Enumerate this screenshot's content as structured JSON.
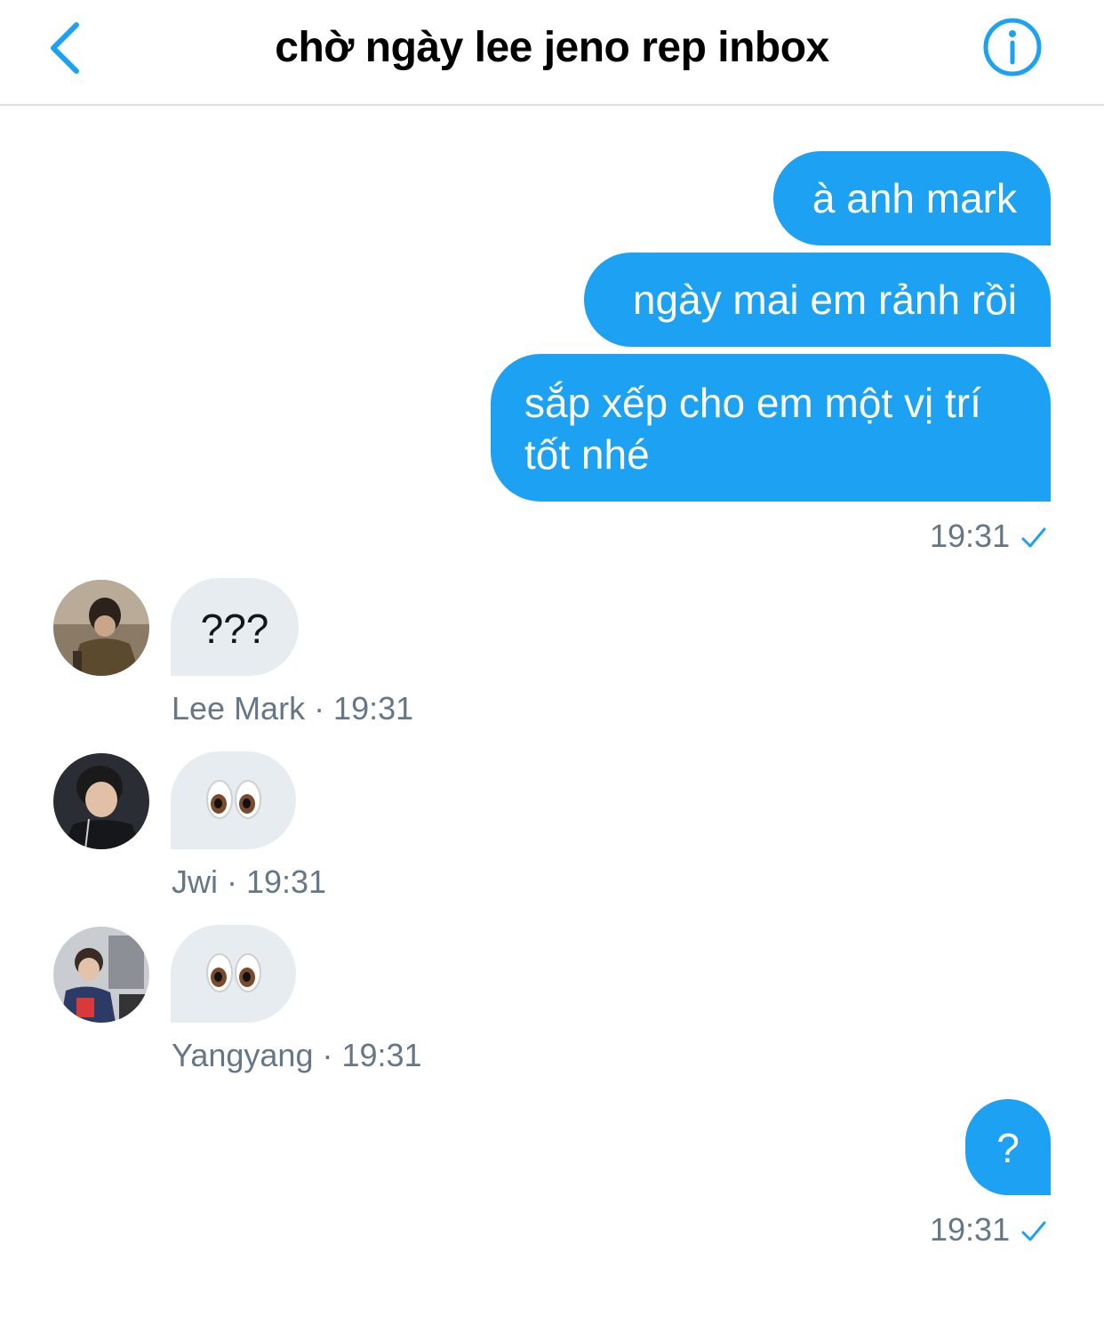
{
  "header": {
    "title": "chờ ngày lee jeno rep inbox",
    "back_icon": "chevron-left-icon",
    "info_icon": "info-icon"
  },
  "colors": {
    "accent": "#1da1f2",
    "incoming_bubble": "#e6ecf0",
    "meta_text": "#657786"
  },
  "messages": {
    "out1": "à anh mark",
    "out2": "ngày mai em rảnh rồi",
    "out3": "sắp xếp cho em một vị trí tốt nhé",
    "out_time": "19:31",
    "in1_text": "???",
    "in1_meta": "Lee Mark · 19:31",
    "in2_emoji": "👀",
    "in2_meta": "Jwi · 19:31",
    "in3_emoji": "👀",
    "in3_meta": "Yangyang · 19:31",
    "out4": "?",
    "out4_time": "19:31"
  }
}
